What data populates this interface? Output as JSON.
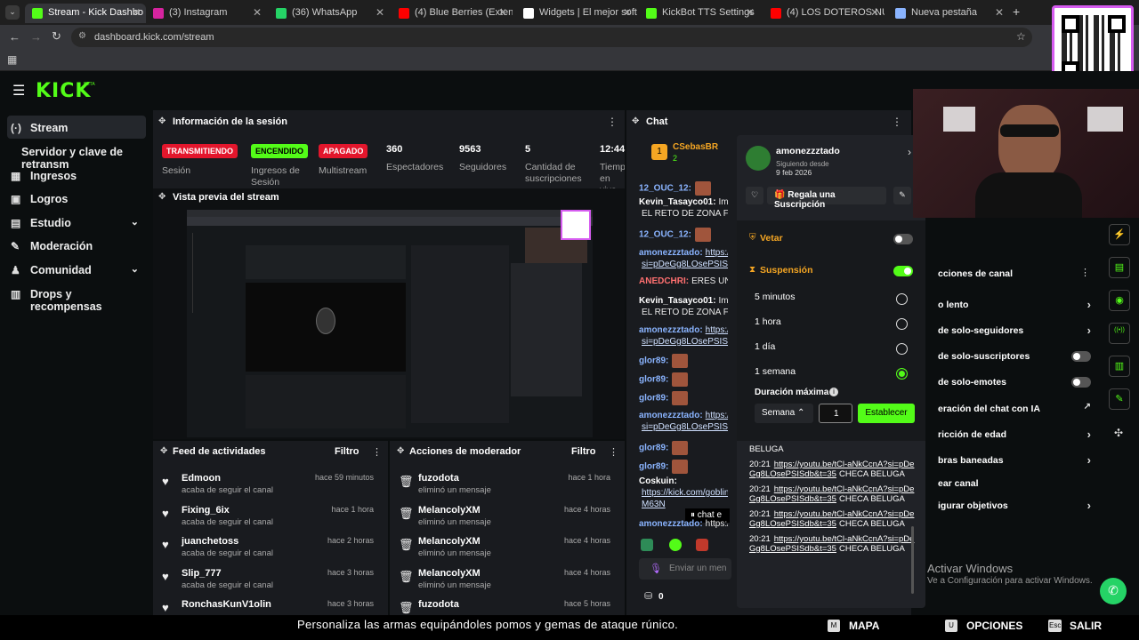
{
  "browser": {
    "tabs": [
      {
        "label": "Stream - Kick Dashbo",
        "color": "#53fc18",
        "active": true
      },
      {
        "label": "(3) Instagram",
        "color": "#d6249f"
      },
      {
        "label": "(36) WhatsApp",
        "color": "#25d366"
      },
      {
        "label": "(4) Blue Berries (Extended",
        "color": "#ff0000"
      },
      {
        "label": "Widgets | El mejor softw",
        "color": "#ffffff"
      },
      {
        "label": "KickBot TTS Settings",
        "color": "#53fc18"
      },
      {
        "label": "(4) LOS DOTEROS NU",
        "color": "#ff0000"
      },
      {
        "label": "Nueva pestaña",
        "color": "#8ab4ff"
      }
    ],
    "url": "dashboard.kick.com/stream"
  },
  "header": {
    "logo": "KICK",
    "logo_sup": "BETA"
  },
  "sidebar": {
    "items": [
      {
        "label": "Stream",
        "icon": "(·)"
      },
      {
        "label": "Servidor y clave de retransm",
        "icon": ""
      },
      {
        "label": "Ingresos",
        "icon": "▦"
      },
      {
        "label": "Logros",
        "icon": "▣"
      },
      {
        "label": "Estudio",
        "icon": "▤"
      },
      {
        "label": "Moderación",
        "icon": "✎"
      },
      {
        "label": "Comunidad",
        "icon": "♟"
      },
      {
        "label": "Drops y recompensas",
        "icon": "▥"
      }
    ]
  },
  "session": {
    "title": "Información de la sesión",
    "badges": [
      {
        "text": "TRANSMITIENDO",
        "label": "Sesión",
        "bg": "#e3162c",
        "fg": "#ffffff"
      },
      {
        "text": "ENCENDIDO",
        "label": "Ingresos de Sesión",
        "bg": "#53fc18",
        "fg": "#000000"
      },
      {
        "text": "APAGADO",
        "label": "Multistream",
        "bg": "#e3162c",
        "fg": "#ffffff"
      }
    ],
    "stats": [
      {
        "value": "360",
        "label": "Espectadores"
      },
      {
        "value": "9563",
        "label": "Seguidores"
      },
      {
        "value": "5",
        "label": "Cantidad de suscripciones"
      },
      {
        "value": "12:44",
        "label": "Tiempo en vivo"
      }
    ]
  },
  "preview": {
    "title": "Vista previa del stream"
  },
  "activity": {
    "title": "Feed de actividades",
    "filter": "Filtro",
    "rows": [
      {
        "name": "Edmoon",
        "sub": "acaba de seguir el canal",
        "time": "hace 59 minutos"
      },
      {
        "name": "Fixing_6ix",
        "sub": "acaba de seguir el canal",
        "time": "hace 1 hora"
      },
      {
        "name": "juanchetoss",
        "sub": "acaba de seguir el canal",
        "time": "hace 2 horas"
      },
      {
        "name": "Slip_777",
        "sub": "acaba de seguir el canal",
        "time": "hace 3 horas"
      },
      {
        "name": "RonchasKunV1olin",
        "sub": "",
        "time": "hace 3 horas"
      }
    ]
  },
  "modactions": {
    "title": "Acciones de moderador",
    "filter": "Filtro",
    "rows": [
      {
        "name": "fuzodota",
        "sub": "eliminó un mensaje",
        "time": "hace 1 hora"
      },
      {
        "name": "MelancolyXM",
        "sub": "eliminó un mensaje",
        "time": "hace 4 horas"
      },
      {
        "name": "MelancolyXM",
        "sub": "eliminó un mensaje",
        "time": "hace 4 horas"
      },
      {
        "name": "MelancolyXM",
        "sub": "eliminó un mensaje",
        "time": "hace 4 horas"
      },
      {
        "name": "fuzodota",
        "sub": "",
        "time": "hace 5 horas"
      }
    ]
  },
  "chat": {
    "title": "Chat",
    "pinned_user": "CSebasBR",
    "pinned_count": "2",
    "lines": [
      {
        "user": "12_OUC_12:",
        "text": "",
        "cls": "u-blue",
        "emote": true
      },
      {
        "user": "Kevin_Tasayco01:",
        "text": "Imura",
        "cls": "u-white"
      },
      {
        "user": "",
        "text": "EL RETO DE ZONA FRAN",
        "cls": ""
      },
      {
        "user": "12_OUC_12:",
        "text": "",
        "cls": "u-blue",
        "emote": true
      },
      {
        "user": "amonezzztado:",
        "text": "https://",
        "cls": "u-blue",
        "link": true
      },
      {
        "user": "",
        "text": "si=pDeGg8LOsePSISdb",
        "cls": "",
        "link": true
      },
      {
        "user": "ANEDCHRI:",
        "text": "ERES UN E",
        "cls": "u-red"
      },
      {
        "user": "Kevin_Tasayco01:",
        "text": "Imura",
        "cls": "u-white"
      },
      {
        "user": "",
        "text": "EL RETO DE ZONA FRAN",
        "cls": ""
      },
      {
        "user": "amonezzztado:",
        "text": "https://",
        "cls": "u-blue",
        "link": true
      },
      {
        "user": "",
        "text": "si=pDeGg8LOsePSISdb",
        "cls": "",
        "link": true
      },
      {
        "user": "glor89:",
        "text": "",
        "cls": "u-blue",
        "emote": true
      },
      {
        "user": "glor89:",
        "text": "",
        "cls": "u-blue",
        "emote": true
      },
      {
        "user": "glor89:",
        "text": "",
        "cls": "u-blue",
        "emote": true
      },
      {
        "user": "amonezzztado:",
        "text": "https://",
        "cls": "u-blue",
        "link": true
      },
      {
        "user": "",
        "text": "si=pDeGg8LOsePSISdb",
        "cls": "",
        "link": true
      },
      {
        "user": "glor89:",
        "text": "",
        "cls": "u-blue",
        "emote": true
      },
      {
        "user": "glor89:",
        "text": "",
        "cls": "u-blue",
        "emote": true
      },
      {
        "user": "Coskuin:",
        "text": "",
        "cls": "u-white"
      },
      {
        "user": "",
        "text": "https://kick.com/goblin",
        "cls": "",
        "link": true
      },
      {
        "user": "",
        "text": "M63N",
        "cls": "",
        "link": true
      },
      {
        "user": "amonezzztado:",
        "text": "https://",
        "cls": "u-blue"
      }
    ],
    "paused": "chat e",
    "input_placeholder": "Enviar un men",
    "points": "0"
  },
  "usercard": {
    "username": "amonezzztado",
    "following_label": "Siguiendo desde",
    "following_date": "9 feb 2026",
    "gift_button": "Regala una Suscripción",
    "ban_label": "Vetar",
    "timeout_label": "Suspensión",
    "options": [
      "5 minutos",
      "1 hora",
      "1 día",
      "1 semana"
    ],
    "selected": 3,
    "max_duration_label": "Duración máxima",
    "unit": "Semana",
    "amount": "1",
    "set_button": "Establecer",
    "messages": [
      {
        "head": "BELUGA",
        "time": "",
        "link": "",
        "tail": ""
      },
      {
        "head": "",
        "time": "20:21",
        "link": "https://youtu.be/tCl-aNkCcnA?si=pDeGg8LOsePSISdb&t=35",
        "tail": "CHECA BELUGA"
      },
      {
        "head": "",
        "time": "20:21",
        "link": "https://youtu.be/tCl-aNkCcnA?si=pDeGg8LOsePSISdb&t=35",
        "tail": "CHECA BELUGA"
      },
      {
        "head": "",
        "time": "20:21",
        "link": "https://youtu.be/tCl-aNkCcnA?si=pDeGg8LOsePSISdb&t=35",
        "tail": "CHECA BELUGA"
      },
      {
        "head": "",
        "time": "20:21",
        "link": "https://youtu.be/tCl-aNkCcnA?si=pDeGg8LOsePSISdb&t=35",
        "tail": "CHECA BELUGA"
      }
    ]
  },
  "channel_settings": {
    "title": "cciones de canal",
    "items": [
      {
        "label": "o lento",
        "kind": "arrow"
      },
      {
        "label": "de solo-seguidores",
        "kind": "arrow"
      },
      {
        "label": "de solo-suscriptores",
        "kind": "toggle"
      },
      {
        "label": "de solo-emotes",
        "kind": "toggle"
      },
      {
        "label": "eración del chat con IA",
        "kind": "ext"
      },
      {
        "label": "ricción de edad",
        "kind": "arrow"
      },
      {
        "label": "bras baneadas",
        "kind": "arrow"
      },
      {
        "label": "ear canal",
        "kind": "none"
      },
      {
        "label": "igurar objetivos",
        "kind": "arrow"
      }
    ]
  },
  "overlay": {
    "subtitle": "Personaliza las armas equipándoles pomos y gemas de ataque rúnico.",
    "windows_title": "Activar Windows",
    "windows_sub": "Ve a Configuración para activar Windows.",
    "hud": [
      {
        "key": "M",
        "label": "MAPA"
      },
      {
        "key": "U",
        "label": "OPCIONES"
      },
      {
        "key": "Esc",
        "label": "SALIR"
      }
    ]
  }
}
